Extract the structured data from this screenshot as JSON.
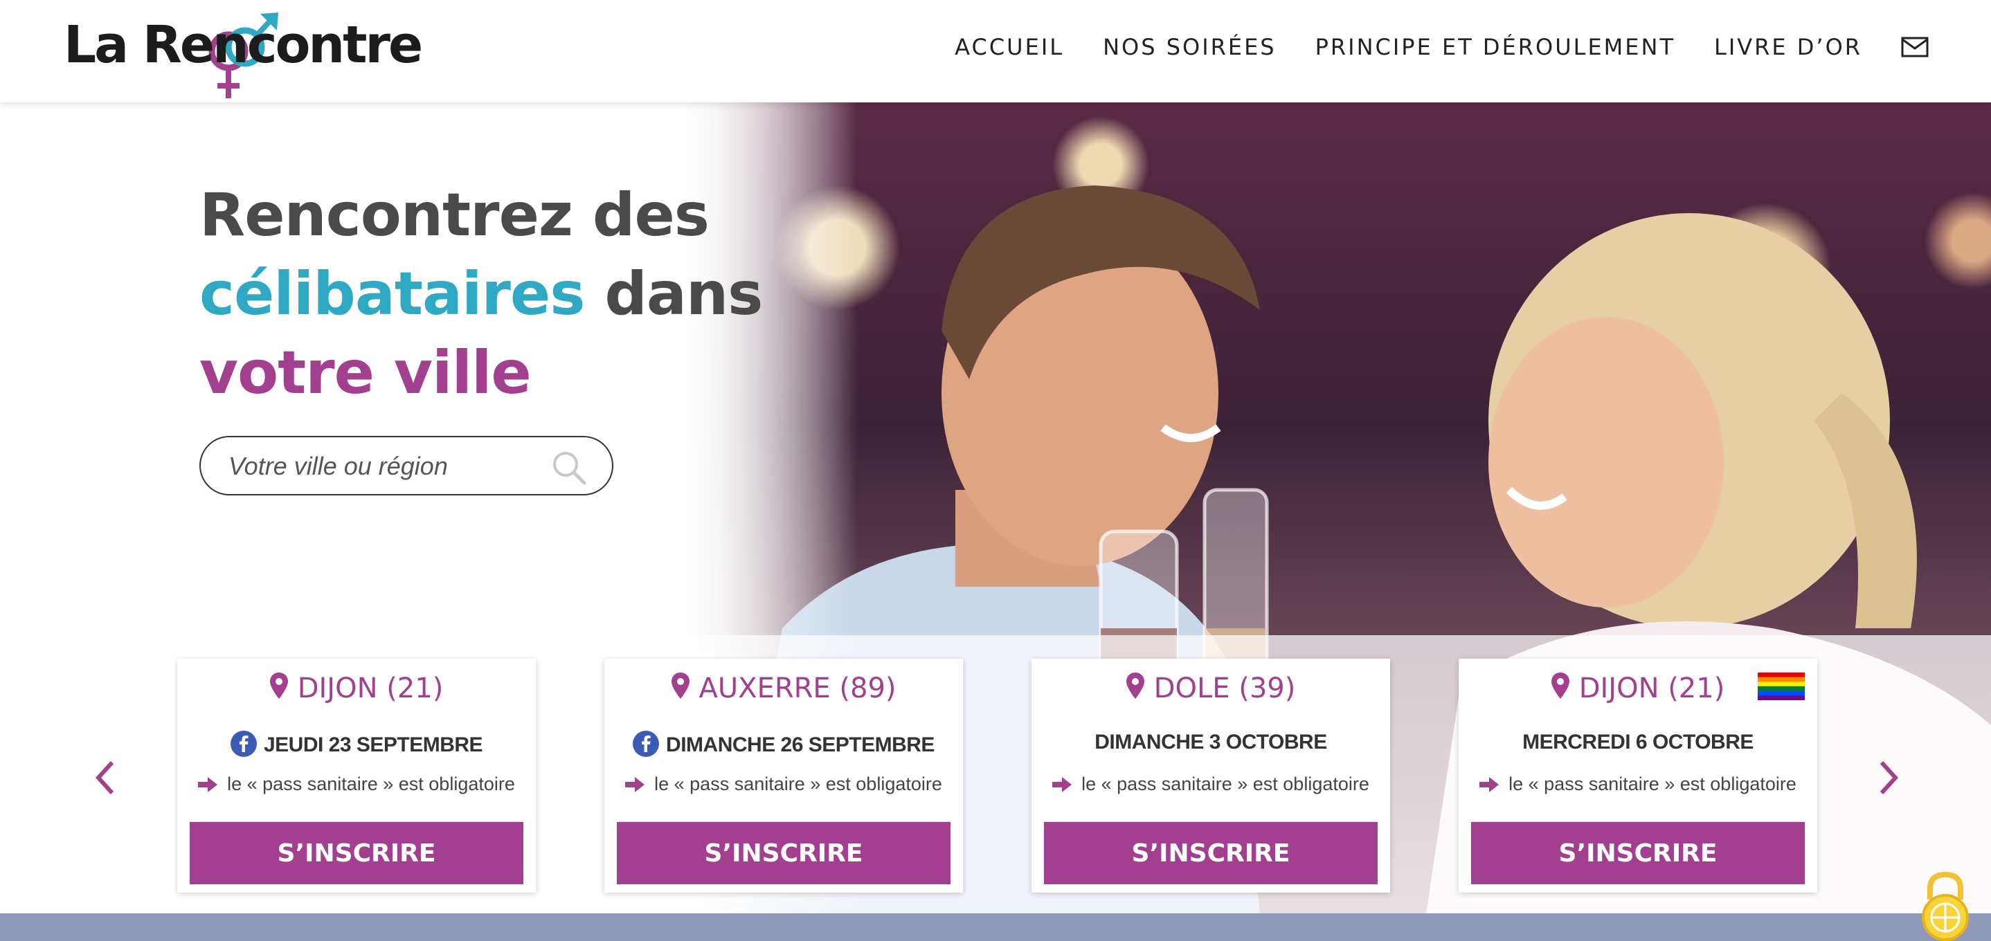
{
  "header": {
    "logo_text": "La Rencontre",
    "nav": [
      "ACCUEIL",
      "NOS SOIRÉES",
      "PRINCIPE ET DÉROULEMENT",
      "LIVRE D’OR"
    ],
    "mail_icon": "mail-icon"
  },
  "hero": {
    "line1": "Rencontrez des",
    "line2_accent": "célibataires",
    "line2_rest": " dans",
    "line3": "votre ville",
    "search_placeholder": "Votre ville ou région"
  },
  "events": [
    {
      "city": "DIJON (21)",
      "date": "JEUDI 23 SEPTEMBRE",
      "facebook": true,
      "rainbow": false,
      "note": "le « pass sanitaire » est obligatoire",
      "button": "S’INSCRIRE"
    },
    {
      "city": "AUXERRE (89)",
      "date": "DIMANCHE 26 SEPTEMBRE",
      "facebook": true,
      "rainbow": false,
      "note": "le « pass sanitaire » est obligatoire",
      "button": "S’INSCRIRE"
    },
    {
      "city": "DOLE (39)",
      "date": "DIMANCHE 3 OCTOBRE",
      "facebook": false,
      "rainbow": false,
      "note": "le « pass sanitaire » est obligatoire",
      "button": "S’INSCRIRE"
    },
    {
      "city": "DIJON (21)",
      "date": "MERCREDI 6 OCTOBRE",
      "facebook": false,
      "rainbow": true,
      "note": "le « pass sanitaire » est obligatoire",
      "button": "S’INSCRIRE"
    }
  ],
  "colors": {
    "brand_purple": "#a23f8f",
    "brand_teal": "#2ea8c3",
    "text_dark": "#4a4a4a",
    "footer_bar": "#8f9abb"
  }
}
